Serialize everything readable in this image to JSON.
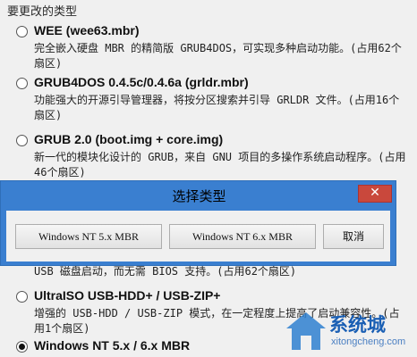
{
  "section": {
    "title": "要更改的类型"
  },
  "options": [
    {
      "title": "WEE (wee63.mbr)",
      "desc": "完全嵌入硬盘 MBR 的精简版 GRUB4DOS，可实现多种启动功能。(占用62个扇区)"
    },
    {
      "title": "GRUB4DOS 0.4.5c/0.4.6a (grldr.mbr)",
      "desc": "功能强大的开源引导管理器，将按分区搜索并引导 GRLDR 文件。(占用16个扇区)"
    },
    {
      "title": "GRUB 2.0 (boot.img + core.img)",
      "desc": "新一代的模块化设计的 GRUB，来自 GNU 项目的多操作系统启动程序。(占用46个扇区)"
    },
    {
      "title": "UltraISO USB-HDD+ / USB-ZIP+",
      "desc": "增强的 USB-HDD / USB-ZIP 模式，在一定程度上提高了启动兼容性。(占用1个扇区)"
    },
    {
      "title": "Windows NT 5.x / 6.x MBR",
      "desc": ""
    }
  ],
  "partial_text": "USB 磁盘启动，而无需 BIOS 支持。(占用62个扇区)",
  "dialog": {
    "title": "选择类型",
    "close": "✕",
    "btn_nt5": "Windows NT 5.x MBR",
    "btn_nt6": "Windows NT 6.x MBR",
    "btn_cancel": "取消"
  },
  "watermark": {
    "text": "系统城",
    "url": "xitongcheng.com"
  }
}
